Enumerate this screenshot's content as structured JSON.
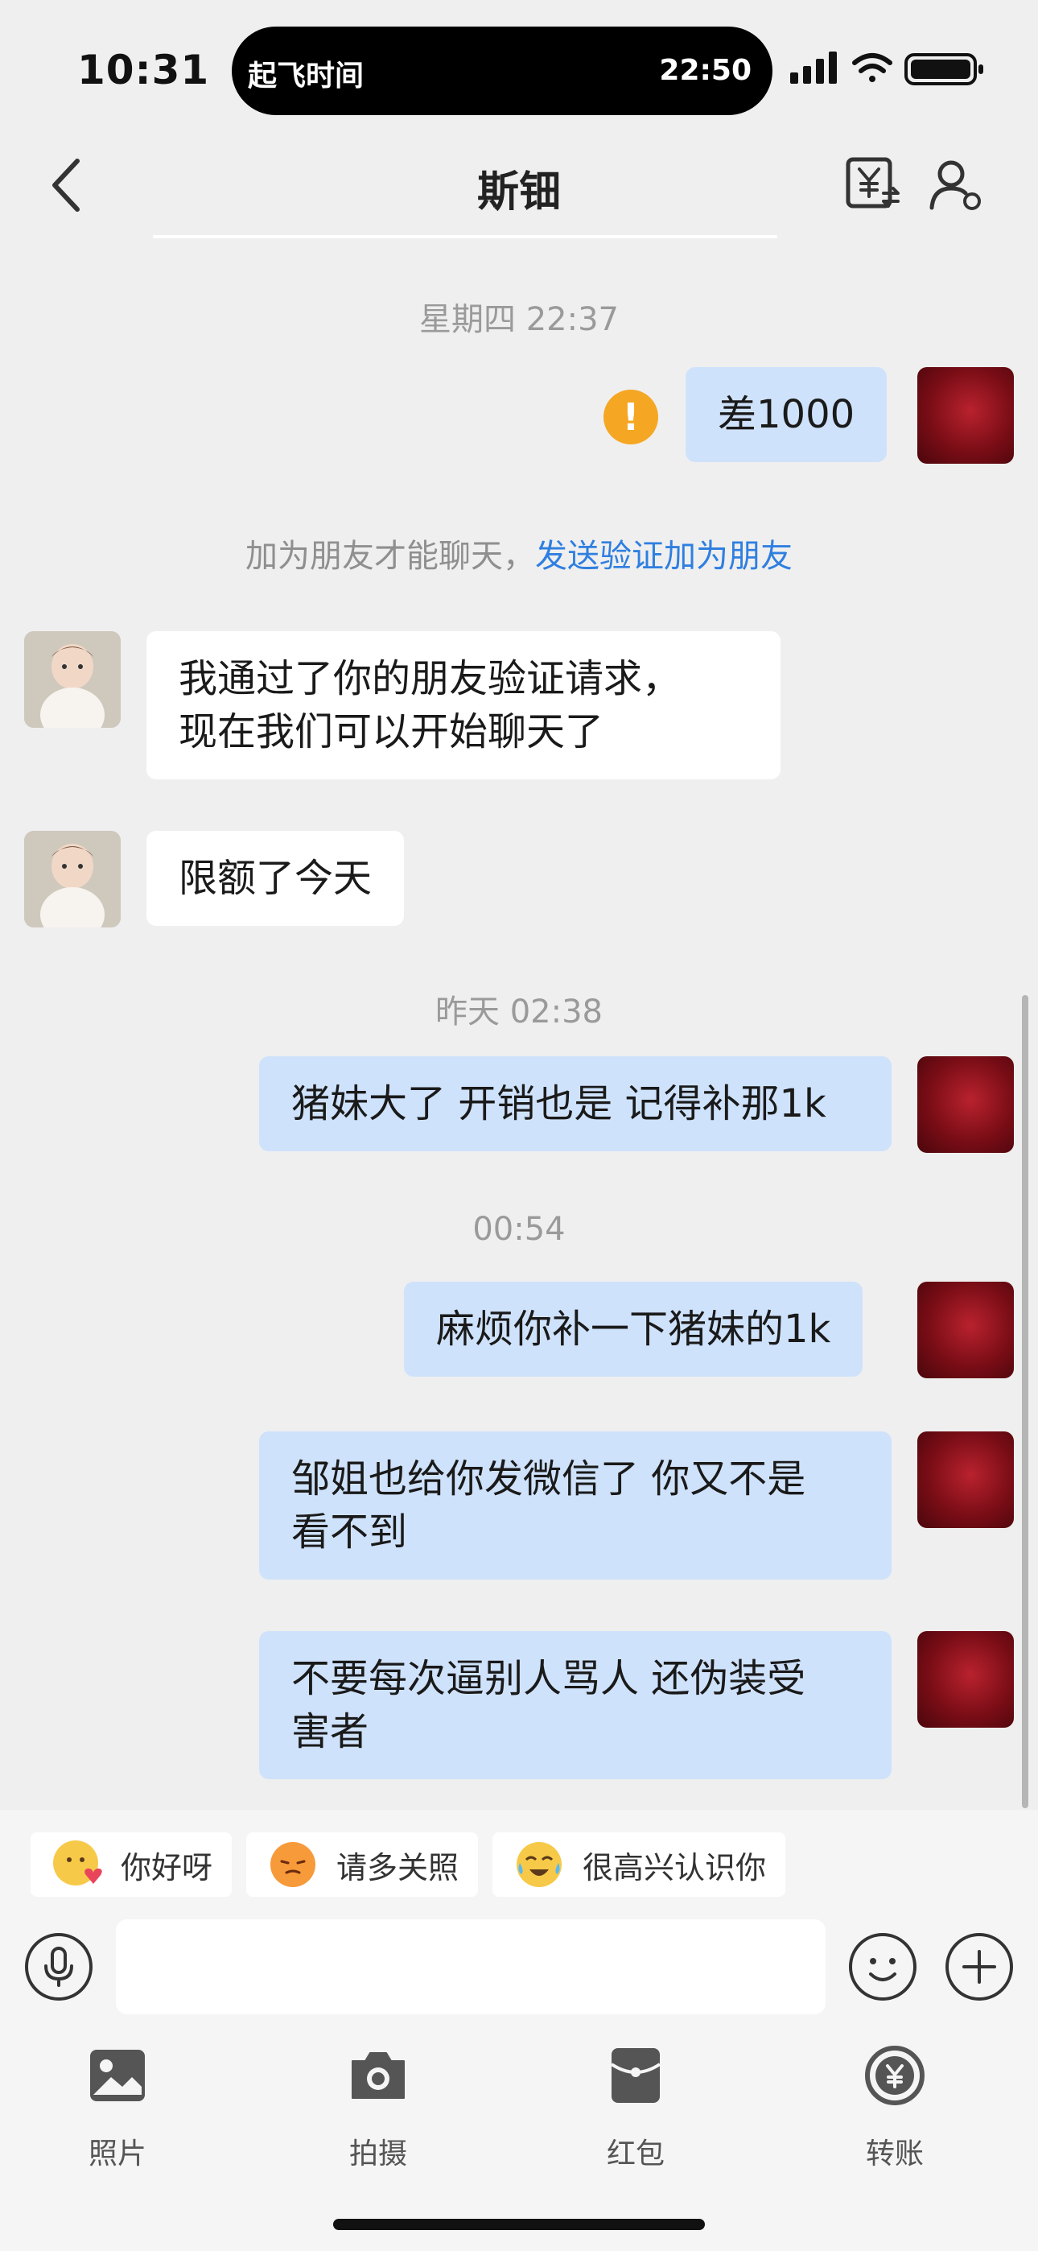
{
  "status_bar": {
    "time": "10:31",
    "island_left": "起飞时间",
    "island_right": "22:50"
  },
  "header": {
    "title": "斯钿",
    "icons": [
      "back-icon",
      "currency-exchange-icon",
      "person-settings-icon"
    ]
  },
  "chat": {
    "time1": "星期四 22:37",
    "msg_out_1": "差1000",
    "system_text": "加为朋友才能聊天，",
    "system_link": "发送验证加为朋友",
    "msg_in_1_line1": "我通过了你的朋友验证请求，",
    "msg_in_1_line2": "现在我们可以开始聊天了",
    "msg_in_2": "限额了今天",
    "time2": "昨天 02:38",
    "msg_out_2": "猪妹大了 开销也是 记得补那1k",
    "time3": "00:54",
    "msg_out_3": "麻烦你补一下猪妹的1k",
    "msg_out_4_line1": "邹姐也给你发微信了 你又不是",
    "msg_out_4_line2": "看不到",
    "msg_out_5_line1": "不要每次逼别人骂人 还伪装受",
    "msg_out_5_line2": "害者"
  },
  "quick_replies": [
    "你好呀",
    "请多关照",
    "很高兴认识你"
  ],
  "toolbar": {
    "photo": "照片",
    "camera": "拍摄",
    "red_packet": "红包",
    "transfer": "转账"
  },
  "colors": {
    "outgoing_bubble": "#cfe2fb",
    "incoming_bubble": "#ffffff",
    "link": "#2f7fe0",
    "warning": "#f5a623",
    "background": "#efefef"
  }
}
